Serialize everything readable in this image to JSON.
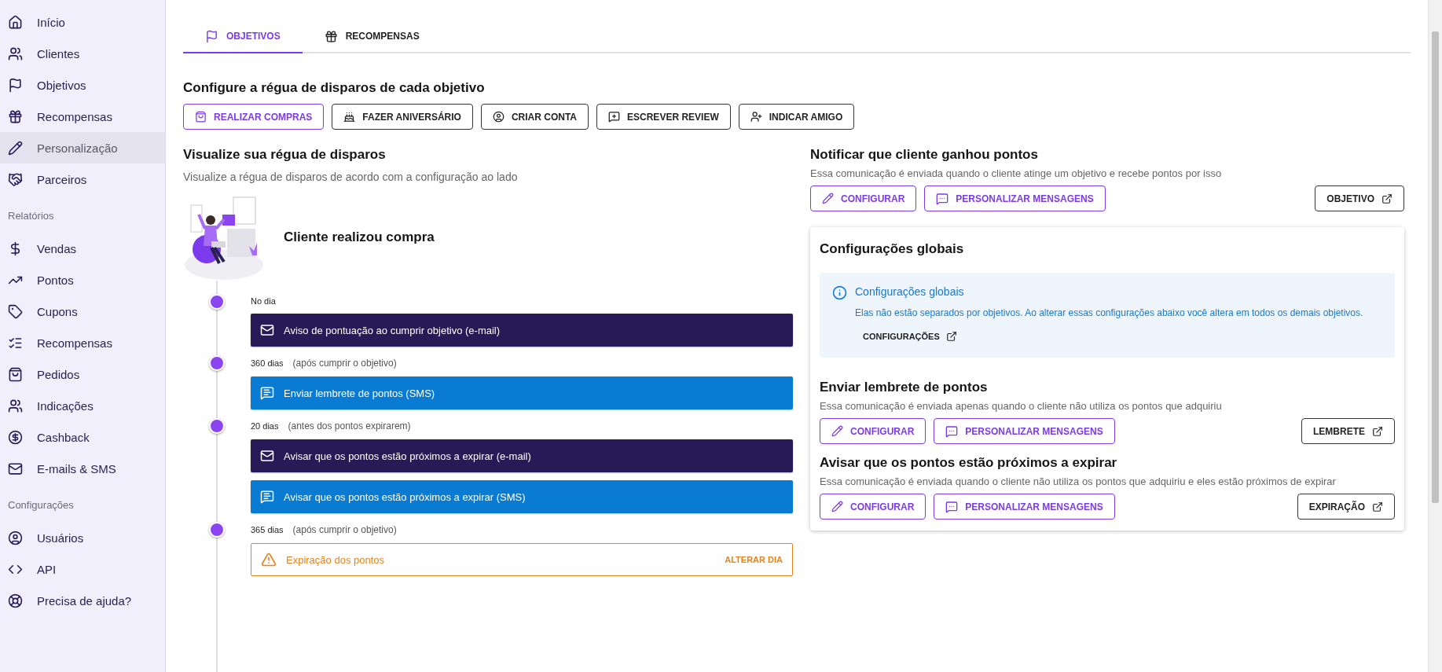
{
  "sidebar": {
    "groups": [
      {
        "items": [
          {
            "label": "Início",
            "selected": false
          },
          {
            "label": "Clientes",
            "selected": false
          },
          {
            "label": "Objetivos",
            "selected": false
          },
          {
            "label": "Recompensas",
            "selected": false
          },
          {
            "label": "Personalização",
            "selected": true
          },
          {
            "label": "Parceiros",
            "selected": false
          }
        ]
      },
      {
        "title": "Relatórios",
        "items": [
          {
            "label": "Vendas",
            "selected": false
          },
          {
            "label": "Pontos",
            "selected": false
          },
          {
            "label": "Cupons",
            "selected": false
          },
          {
            "label": "Recompensas",
            "selected": false
          },
          {
            "label": "Pedidos",
            "selected": false
          },
          {
            "label": "Indicações",
            "selected": false
          },
          {
            "label": "Cashback",
            "selected": false
          },
          {
            "label": "E-mails & SMS",
            "selected": false
          }
        ]
      },
      {
        "title": "Configurações",
        "items": [
          {
            "label": "Usuários",
            "selected": false
          },
          {
            "label": "API",
            "selected": false
          },
          {
            "label": "Precisa de ajuda?",
            "selected": false
          }
        ]
      }
    ]
  },
  "tabs": [
    {
      "label": "OBJETIVOS",
      "selected": true
    },
    {
      "label": "RECOMPENSAS",
      "selected": false
    }
  ],
  "objectives": {
    "title": "Configure a régua de disparos de cada objetivo",
    "buttons": [
      {
        "label": "REALIZAR COMPRAS",
        "selected": true
      },
      {
        "label": "FAZER ANIVERSÁRIO",
        "selected": false
      },
      {
        "label": "CRIAR CONTA",
        "selected": false
      },
      {
        "label": "ESCREVER REVIEW",
        "selected": false
      },
      {
        "label": "INDICAR AMIGO",
        "selected": false
      }
    ]
  },
  "timeline": {
    "title": "Visualize sua régua de disparos",
    "subtitle": "Visualize a régua de disparos de acordo com a configuração ao lado",
    "trigger": "Cliente realizou compra",
    "events": [
      {
        "when": "No dia",
        "messages": [
          {
            "kind": "email",
            "label": "Aviso de pontuação ao cumprir objetivo (e-mail)"
          }
        ]
      },
      {
        "when": "360 dias",
        "note": "(após cumprir o objetivo)",
        "messages": [
          {
            "kind": "sms",
            "label": "Enviar lembrete de pontos (SMS)"
          }
        ]
      },
      {
        "when": "20 dias",
        "note": "(antes dos pontos expirarem)",
        "messages": [
          {
            "kind": "email",
            "label": "Avisar que os pontos estão próximos a expirar (e-mail)"
          },
          {
            "kind": "sms",
            "label": "Avisar que os pontos estão próximos a expirar (SMS)"
          }
        ]
      },
      {
        "when": "365 dias",
        "note": "(após cumprir o objetivo)",
        "messages": [
          {
            "kind": "warning",
            "label": "Expiração dos pontos",
            "action": "ALTERAR DIA"
          }
        ]
      }
    ]
  },
  "notify": {
    "title": "Notificar que cliente ganhou pontos",
    "description": "Essa comunicação é enviada quando o cliente atinge um objetivo e recebe pontos por isso",
    "configure": "CONFIGURAR",
    "customize": "PERSONALIZAR MENSAGENS",
    "link": "OBJETIVO"
  },
  "global_card": {
    "title": "Configurações globais",
    "alert": {
      "title": "Configurações globais",
      "text": "Elas não estão separados por objetivos. Ao alterar essas configurações abaixo você altera em todos os demais objetivos.",
      "link": "CONFIGURAÇÕES"
    },
    "sections": [
      {
        "title": "Enviar lembrete de pontos",
        "description": "Essa comunicação é enviada apenas quando o cliente não utiliza os pontos que adquiriu",
        "configure": "CONFIGURAR",
        "customize": "PERSONALIZAR MENSAGENS",
        "link": "LEMBRETE"
      },
      {
        "title": "Avisar que os pontos estão próximos a expirar",
        "description": "Essa comunicação é enviada quando o cliente não utiliza os pontos que adquiriu e eles estão próximos de expirar",
        "configure": "CONFIGURAR",
        "customize": "PERSONALIZAR MENSAGENS",
        "link": "EXPIRAÇÃO"
      }
    ]
  }
}
